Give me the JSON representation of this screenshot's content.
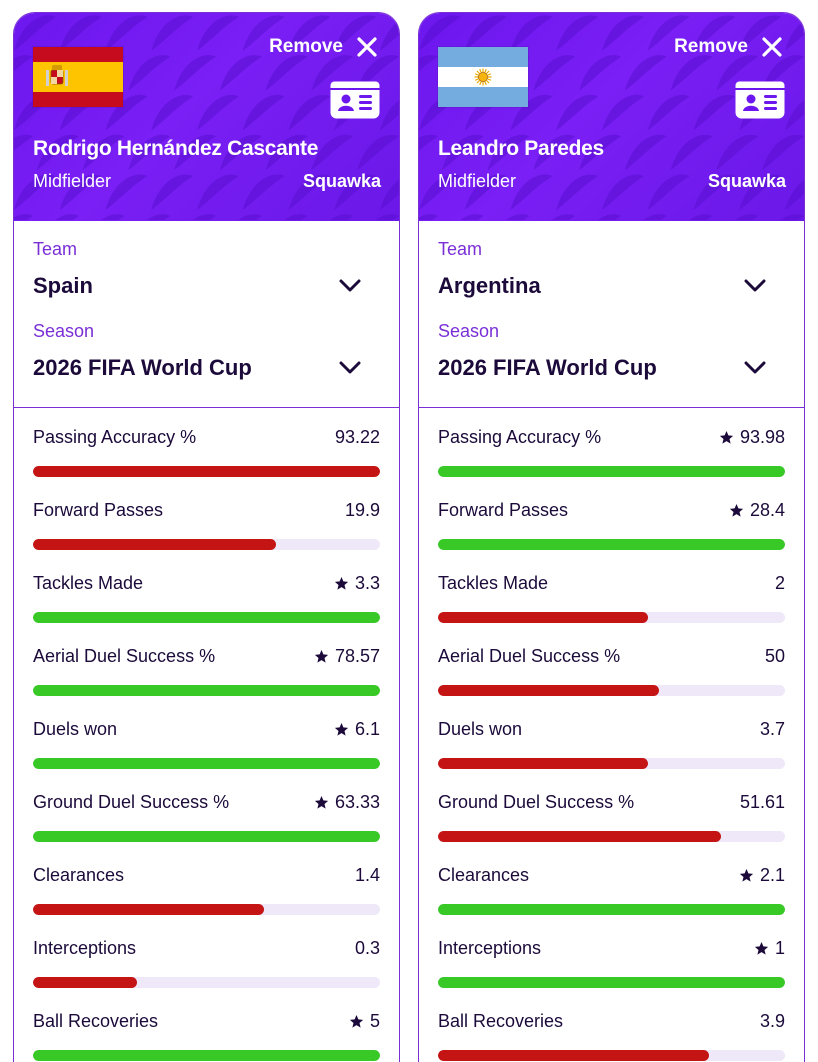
{
  "colors": {
    "header_bg": "#6c17ee",
    "accent": "#7a2fd6",
    "good": "#38c926",
    "bad": "#c41414",
    "track": "#eee8f8"
  },
  "players": [
    {
      "flag": "spain-flag",
      "remove_label": "Remove",
      "name": "Rodrigo Hernández Cascante",
      "position": "Midfielder",
      "source": "Squawka",
      "team_label": "Team",
      "team_value": "Spain",
      "season_label": "Season",
      "season_value": "2026 FIFA World Cup",
      "stats": [
        {
          "name": "Passing Accuracy %",
          "value": "93.22",
          "star": false,
          "fill": 1.0,
          "status": "bad"
        },
        {
          "name": "Forward Passes",
          "value": "19.9",
          "star": false,
          "fill": 0.7,
          "status": "bad"
        },
        {
          "name": "Tackles Made",
          "value": "3.3",
          "star": true,
          "fill": 1.0,
          "status": "good"
        },
        {
          "name": "Aerial Duel Success %",
          "value": "78.57",
          "star": true,
          "fill": 1.0,
          "status": "good"
        },
        {
          "name": "Duels won",
          "value": "6.1",
          "star": true,
          "fill": 1.0,
          "status": "good"
        },
        {
          "name": "Ground Duel Success %",
          "value": "63.33",
          "star": true,
          "fill": 1.0,
          "status": "good"
        },
        {
          "name": "Clearances",
          "value": "1.4",
          "star": false,
          "fill": 0.667,
          "status": "bad"
        },
        {
          "name": "Interceptions",
          "value": "0.3",
          "star": false,
          "fill": 0.3,
          "status": "bad"
        },
        {
          "name": "Ball Recoveries",
          "value": "5",
          "star": true,
          "fill": 1.0,
          "status": "good"
        }
      ]
    },
    {
      "flag": "argentina-flag",
      "remove_label": "Remove",
      "name": "Leandro Paredes",
      "position": "Midfielder",
      "source": "Squawka",
      "team_label": "Team",
      "team_value": "Argentina",
      "season_label": "Season",
      "season_value": "2026 FIFA World Cup",
      "stats": [
        {
          "name": "Passing Accuracy %",
          "value": "93.98",
          "star": true,
          "fill": 1.0,
          "status": "good"
        },
        {
          "name": "Forward Passes",
          "value": "28.4",
          "star": true,
          "fill": 1.0,
          "status": "good"
        },
        {
          "name": "Tackles Made",
          "value": "2",
          "star": false,
          "fill": 0.606,
          "status": "bad"
        },
        {
          "name": "Aerial Duel Success %",
          "value": "50",
          "star": false,
          "fill": 0.636,
          "status": "bad"
        },
        {
          "name": "Duels won",
          "value": "3.7",
          "star": false,
          "fill": 0.606,
          "status": "bad"
        },
        {
          "name": "Ground Duel Success %",
          "value": "51.61",
          "star": false,
          "fill": 0.815,
          "status": "bad"
        },
        {
          "name": "Clearances",
          "value": "2.1",
          "star": true,
          "fill": 1.0,
          "status": "good"
        },
        {
          "name": "Interceptions",
          "value": "1",
          "star": true,
          "fill": 1.0,
          "status": "good"
        },
        {
          "name": "Ball Recoveries",
          "value": "3.9",
          "star": false,
          "fill": 0.78,
          "status": "bad"
        }
      ]
    }
  ]
}
